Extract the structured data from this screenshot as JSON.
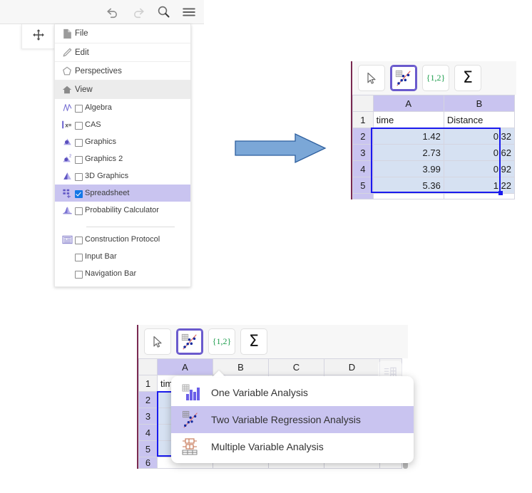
{
  "appbar": {
    "icons": [
      {
        "name": "undo-icon",
        "label": "Undo"
      },
      {
        "name": "redo-icon",
        "label": "Redo"
      },
      {
        "name": "search-icon",
        "label": "Search"
      },
      {
        "name": "hamburger-menu-icon",
        "label": "Main Menu"
      }
    ]
  },
  "drag_handle": {
    "label": "Move panel"
  },
  "menu": {
    "top_items": [
      {
        "label": "File",
        "icon": "file-icon"
      },
      {
        "label": "Edit",
        "icon": "pencil-icon"
      },
      {
        "label": "Perspectives",
        "icon": "perspectives-icon"
      },
      {
        "label": "View",
        "icon": "home-icon"
      }
    ],
    "view_items": [
      {
        "label": "Algebra",
        "icon": "algebra-icon",
        "checked": false
      },
      {
        "label": "CAS",
        "icon": "cas-icon",
        "checked": false
      },
      {
        "label": "Graphics",
        "icon": "graphics-icon",
        "checked": false
      },
      {
        "label": "Graphics 2",
        "icon": "graphics2-icon",
        "checked": false
      },
      {
        "label": "3D Graphics",
        "icon": "graphics3d-icon",
        "checked": false
      },
      {
        "label": "Spreadsheet",
        "icon": "spreadsheet-icon",
        "checked": true
      },
      {
        "label": "Probability Calculator",
        "icon": "probability-icon",
        "checked": false
      }
    ],
    "extra_items": [
      {
        "label": "Construction Protocol",
        "icon": "construction-protocol-icon",
        "checked": false
      },
      {
        "label": "Input Bar",
        "icon": "none",
        "checked": false
      },
      {
        "label": "Navigation Bar",
        "icon": "none",
        "checked": false
      }
    ]
  },
  "arrow": {
    "name": "right-arrow",
    "fill": "#7ba7d7",
    "stroke": "#2e5f9e"
  },
  "spreadsheet": {
    "toolbar": [
      {
        "name": "pointer-tool",
        "label": "",
        "active": false
      },
      {
        "name": "two-variable-regression-tool",
        "label": "",
        "active": true
      },
      {
        "name": "set-tool",
        "label": "{1,2}",
        "active": false
      },
      {
        "name": "sum-tool",
        "label": "Σ",
        "active": false
      }
    ],
    "columns_short": [
      "A",
      "B"
    ],
    "columns_long": [
      "A",
      "B",
      "C",
      "D"
    ],
    "row_numbers": [
      "1",
      "2",
      "3",
      "4",
      "5",
      "6"
    ],
    "header_row": [
      "time",
      "Distance"
    ],
    "rows": [
      [
        "1.42",
        "0.32"
      ],
      [
        "2.73",
        "0.62"
      ],
      [
        "3.99",
        "0.92"
      ],
      [
        "5.36",
        "1.22"
      ]
    ]
  },
  "popup": {
    "items": [
      {
        "label": "One Variable Analysis",
        "icon": "bar-chart-icon",
        "highlighted": false
      },
      {
        "label": "Two Variable Regression Analysis",
        "icon": "scatter-regression-icon",
        "highlighted": true
      },
      {
        "label": "Multiple Variable Analysis",
        "icon": "boxplot-icon",
        "highlighted": false
      }
    ]
  },
  "colors": {
    "accent_purple": "#c9c4f0",
    "selection_blue": "#1a1aee",
    "selection_fill": "#d6e1f2",
    "arrow_blue": "#7ba7d7",
    "green_text": "#1f9e4e"
  }
}
